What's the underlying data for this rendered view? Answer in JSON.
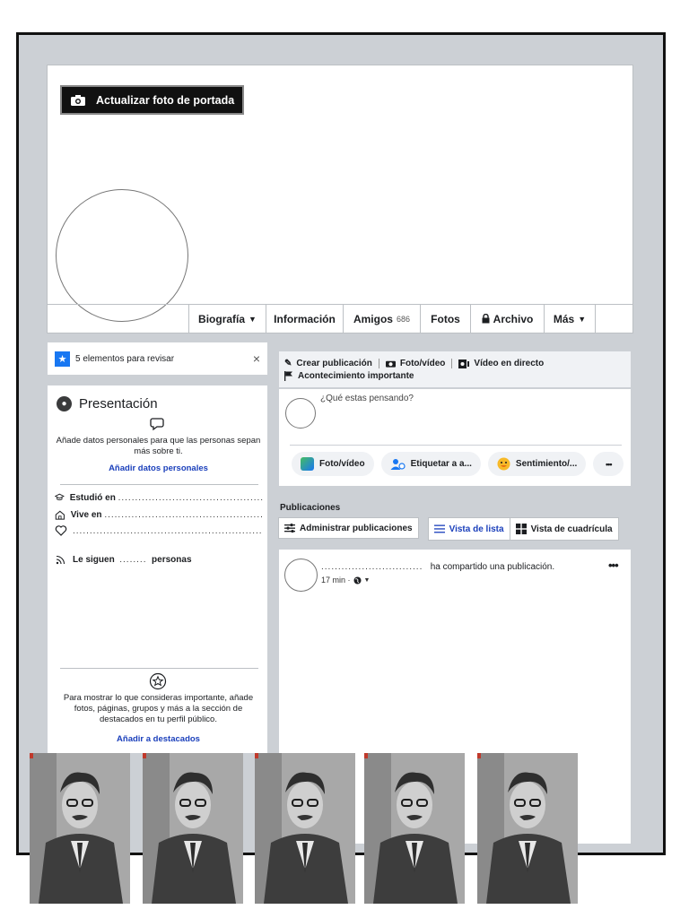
{
  "cover": {
    "update_button": "Actualizar foto de portada"
  },
  "tabs": [
    {
      "label": "Biografía",
      "caret": "▼"
    },
    {
      "label": "Información"
    },
    {
      "label": "Amigos",
      "count": "686"
    },
    {
      "label": "Fotos"
    },
    {
      "label": "Archivo"
    },
    {
      "label": "Más",
      "caret": "▼"
    }
  ],
  "review": {
    "text": "5 elementos para revisar",
    "close": "×"
  },
  "intro": {
    "title": "Presentación",
    "description": "Añade datos personales para que las personas sepan más sobre ti.",
    "link": "Añadir datos personales",
    "studied": "Estudió en",
    "lives": "Vive en",
    "followers_prefix": "Le siguen",
    "followers_suffix": "personas",
    "dots": "........................................................",
    "dots_short": "........",
    "featured_desc": "Para mostrar lo que consideras importante, añade fotos, páginas, grupos y más a la sección de destacados en tu perfil público.",
    "featured_link": "Añadir a destacados"
  },
  "composer": {
    "create": "Crear publicación",
    "photo_video": "Foto/vídeo",
    "live": "Vídeo en directo",
    "event": "Acontecimiento importante",
    "placeholder": "¿Qué estas pensando?",
    "btn_photo": "Foto/vídeo",
    "btn_tag": "Etiquetar a a...",
    "btn_feeling": "Sentimiento/...",
    "btn_more": "•••"
  },
  "publications": {
    "title": "Publicaciones",
    "manage": "Administrar publicaciones",
    "list_view": "Vista de lista",
    "grid_view": "Vista de cuadrícula"
  },
  "post": {
    "author_dots": "..............................",
    "action": "ha compartido una publicación.",
    "time": "17 min ·",
    "more": "•••"
  },
  "colors": {
    "accent": "#1877f2",
    "link": "#1a3fbb",
    "frame_bg": "#ccd0d5"
  }
}
